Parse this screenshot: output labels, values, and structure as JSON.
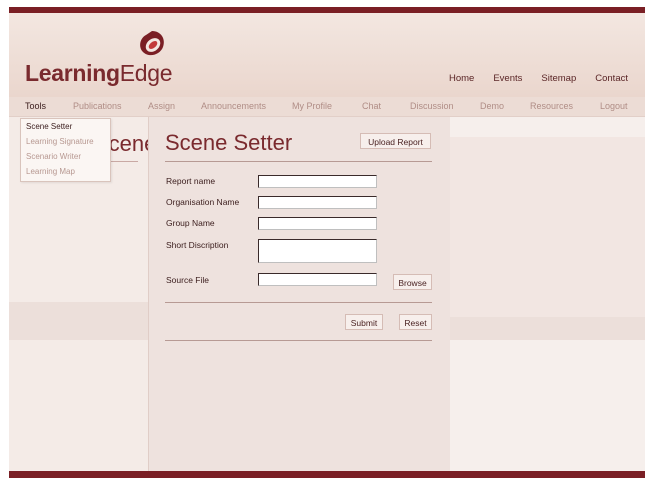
{
  "brand": {
    "name_bold": "Learning",
    "name_regular": "Edge",
    "logo_icon": "red-swirl-icon",
    "accent": "#7a1f25"
  },
  "top_links": [
    "Home",
    "Events",
    "Sitemap",
    "Contact"
  ],
  "nav": [
    "Tools",
    "Publications",
    "Assign",
    "Announcements",
    "My Profile",
    "Chat",
    "Discussion",
    "Demo",
    "Resources",
    "Logout"
  ],
  "tools_menu": [
    "Scene Setter",
    "Learning Signature",
    "Scenario Writer",
    "Learning Map"
  ],
  "background_title": "Scene Setter",
  "form": {
    "title": "Scene Setter",
    "upload_label": "Upload Report",
    "fields": {
      "report_name": {
        "label": "Report name",
        "value": ""
      },
      "organisation_name": {
        "label": "Organisation Name",
        "value": ""
      },
      "group_name": {
        "label": "Group Name",
        "value": ""
      },
      "short_description": {
        "label": "Short  Discription",
        "value": ""
      },
      "source_file": {
        "label": "Source File",
        "value": ""
      }
    },
    "browse_label": "Browse",
    "submit_label": "Submit",
    "reset_label": "Reset"
  }
}
